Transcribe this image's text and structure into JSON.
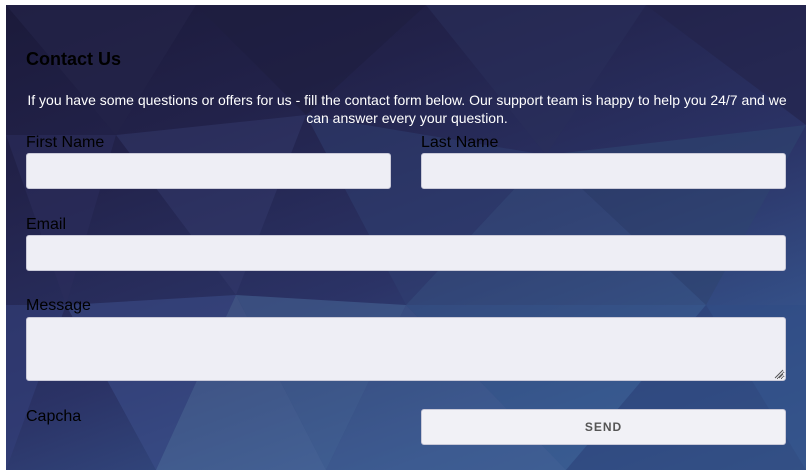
{
  "form": {
    "title": "Contact Us",
    "intro": "If you have some questions or offers for us - fill the contact form below. Our support team is happy to help you 24/7 and we can answer every your question.",
    "first_name": {
      "label": "First Name",
      "value": "",
      "placeholder": ""
    },
    "last_name": {
      "label": "Last Name",
      "value": "",
      "placeholder": ""
    },
    "email": {
      "label": "Email",
      "value": "",
      "placeholder": ""
    },
    "message": {
      "label": "Message",
      "value": "",
      "placeholder": ""
    },
    "captcha": {
      "label": "Capcha"
    },
    "send_label": "SEND"
  },
  "colors": {
    "background_dark": "#1b1a3a",
    "background_light": "#3d6296",
    "field_background": "#eeeef5",
    "intro_text": "#ffffff",
    "label_text": "#000000",
    "button_text": "#555555"
  }
}
